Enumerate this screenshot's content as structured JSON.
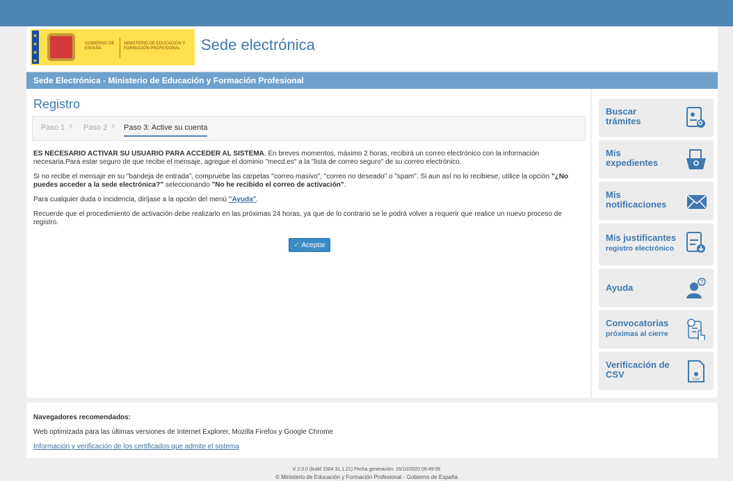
{
  "header": {
    "site_title": "Sede electrónica",
    "logo_gobierno": "GOBIERNO DE ESPAÑA",
    "logo_ministerio": "MINISTERIO DE EDUCACIÓN Y FORMACIÓN PROFESIONAL"
  },
  "bluebar": {
    "title": "Sede Electrónica - Ministerio de Educación y Formación Profesional"
  },
  "main": {
    "title": "Registro",
    "steps": [
      {
        "label": "Paso 1"
      },
      {
        "label": "Paso 2"
      },
      {
        "label": "Paso 3: Active su cuenta"
      }
    ],
    "p1_bold": "ES NECESARIO ACTIVAR SU USUARIO PARA ACCEDER AL SISTEMA",
    "p1_rest": ". En breves momentos, máximo 2 horas, recibirá un correo electrónico con la información necesaria.Para estar seguro de que recibe el mensaje, agregue el dominio \"mecd.es\" a la \"lista de correo seguro\" de su correo electrónico.",
    "p2_a": "Si no recibe el mensaje en su \"bandeja de entrada\", compruebe las carpetas \"correo masivo\", \"correo no deseado\" o \"spam\". Si aun así no lo recibiese, utilice la opción ",
    "p2_b": "\"¿No puedes acceder a la sede electrónica?\"",
    "p2_c": " seleccionando ",
    "p2_d": "\"No he recibido el correo de activación\"",
    "p2_e": ".",
    "p3_a": "Para cualquier duda o incidencia, diríjase a la opción del menú ",
    "p3_link": "\"Ayuda\"",
    "p3_b": ".",
    "p4": "Recuerde que el procedimiento de activación debe realizarlo en las próximas 24 horas, ya que de lo contrario se le podrá volver a requerir que realice un nuevo proceso de registro.",
    "accept_label": "Aceptar"
  },
  "sidebar": {
    "items": [
      {
        "line1": "Buscar",
        "line2": "trámites",
        "icon": "document-search-icon"
      },
      {
        "line1": "Mis",
        "line2": "expedientes",
        "icon": "folder-search-icon"
      },
      {
        "line1": "Mis",
        "line2": "notificaciones",
        "icon": "envelope-icon"
      },
      {
        "line1": "Mis justificantes",
        "line2": "registro electrónico",
        "icon": "document-download-icon"
      },
      {
        "line1": "Ayuda",
        "line2": "",
        "icon": "help-user-icon"
      },
      {
        "line1": "Convocatorias",
        "line2": "próximas al cierre",
        "icon": "calendar-touch-icon"
      },
      {
        "line1": "Verificación de",
        "line2": "CSV",
        "icon": "csv-check-icon"
      }
    ]
  },
  "footer": {
    "browsers_title": "Navegadores recomendados:",
    "browsers_text": "Web optimizada para las últimas versiones de Internet Explorer, Mozilla Firefox y Google Chrome",
    "cert_link": "Información y verificación de los certificados que admite el sistema",
    "version": "V 2.0.0 (build 1584 31.1.21) Fecha generación: 15/10/2020 09:49:06",
    "copyright": "© Ministerio de Educación y Formación Profesional - Gobierno de España"
  },
  "colors": {
    "primary_blue": "#3f78b0",
    "bar_blue": "#6fa1cc",
    "button_blue": "#3a8cc5"
  }
}
